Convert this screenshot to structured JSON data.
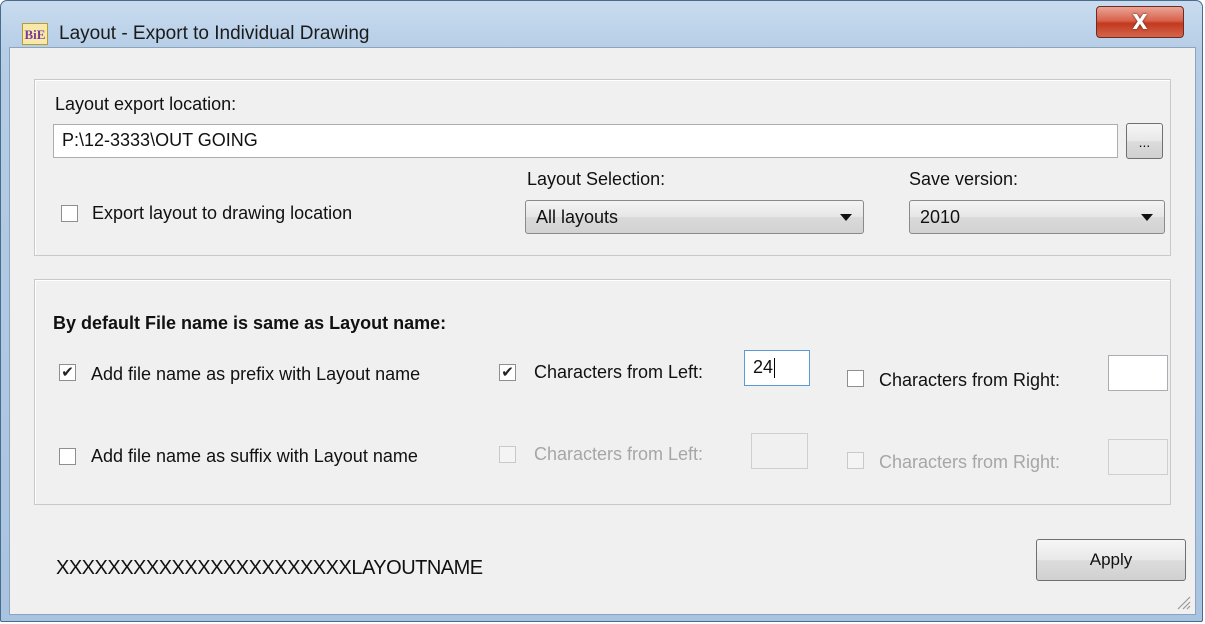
{
  "window": {
    "title": "Layout - Export to Individual Drawing",
    "icon_text": "BiE",
    "close_glyph": "X"
  },
  "export_group": {
    "location_label": "Layout export location:",
    "location_value": "P:\\12-3333\\OUT GOING",
    "browse_label": "...",
    "export_to_drawing_label": "Export layout to drawing location",
    "export_to_drawing_checked": false,
    "layout_selection_label": "Layout Selection:",
    "layout_selection_value": "All layouts",
    "save_version_label": "Save version:",
    "save_version_value": "2010"
  },
  "naming_group": {
    "heading": "By default File name is same as Layout name:",
    "prefix_label": "Add file name as prefix with Layout name",
    "prefix_checked": true,
    "prefix_left_label": "Characters from Left:",
    "prefix_left_checked": true,
    "prefix_left_value": "24",
    "prefix_right_label": "Characters from Right:",
    "prefix_right_checked": false,
    "prefix_right_value": "",
    "suffix_label": "Add file name as suffix with Layout name",
    "suffix_checked": false,
    "suffix_left_label": "Characters from Left:",
    "suffix_left_checked": false,
    "suffix_left_value": "",
    "suffix_right_label": "Characters from Right:",
    "suffix_right_checked": false,
    "suffix_right_value": ""
  },
  "footer": {
    "preview_text": "XXXXXXXXXXXXXXXXXXXXXXXLAYOUTNAME",
    "apply_label": "Apply"
  }
}
